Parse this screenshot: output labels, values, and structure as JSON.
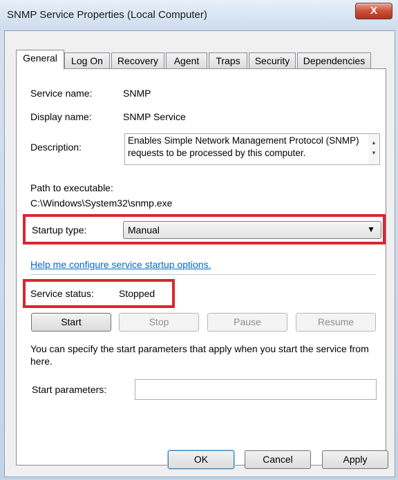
{
  "window": {
    "title": "SNMP Service Properties (Local Computer)",
    "close_glyph": "X"
  },
  "tabs": [
    {
      "label": "General",
      "active": true
    },
    {
      "label": "Log On"
    },
    {
      "label": "Recovery"
    },
    {
      "label": "Agent"
    },
    {
      "label": "Traps"
    },
    {
      "label": "Security"
    },
    {
      "label": "Dependencies"
    }
  ],
  "general": {
    "service_name_label": "Service name:",
    "service_name": "SNMP",
    "display_name_label": "Display name:",
    "display_name": "SNMP Service",
    "description_label": "Description:",
    "description": "Enables Simple Network Management Protocol (SNMP) requests to be processed by this computer.",
    "path_label": "Path to executable:",
    "path": "C:\\Windows\\System32\\snmp.exe",
    "startup_type_label": "Startup type:",
    "startup_type": "Manual",
    "help_link": "Help me configure service startup options.",
    "status_label": "Service status:",
    "status": "Stopped",
    "buttons": {
      "start": "Start",
      "stop": "Stop",
      "pause": "Pause",
      "resume": "Resume"
    },
    "start_params_text": "You can specify the start parameters that apply when you start the service from here.",
    "start_params_label": "Start parameters:",
    "start_params_value": ""
  },
  "footer": {
    "ok": "OK",
    "cancel": "Cancel",
    "apply": "Apply"
  },
  "colors": {
    "highlight": "#d9272e",
    "link": "#0066cc",
    "close_button": "#c9503a"
  }
}
